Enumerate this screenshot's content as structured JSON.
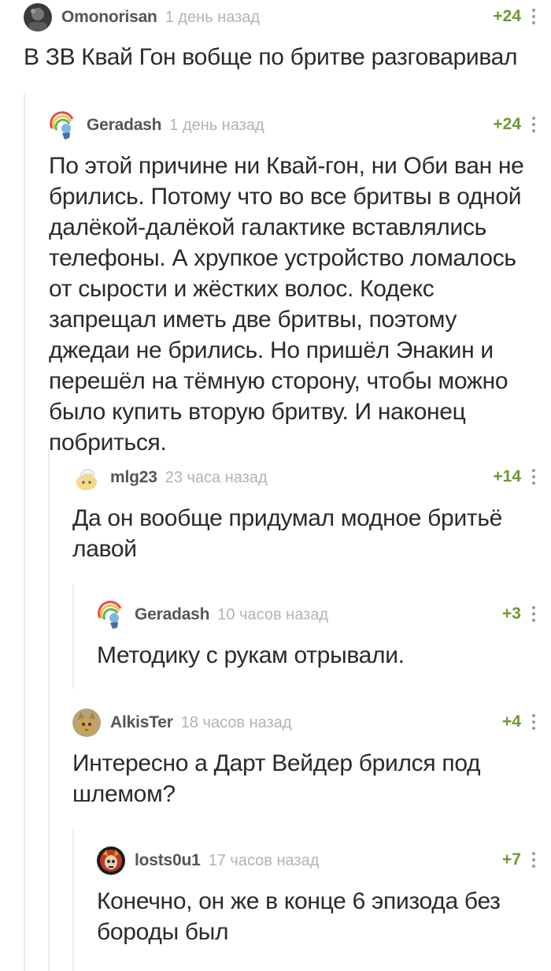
{
  "comments": [
    {
      "author": "Omonorisan",
      "time": "1 день назад",
      "rating": "+24",
      "text": "В ЗВ Квай Гон вобще по бритве разговаривал",
      "avatar": "photo-dark"
    },
    {
      "author": "Geradash",
      "time": "1 день назад",
      "rating": "+24",
      "text": "По этой причине ни Квай-гон, ни Оби ван не брились. Потому что во все бритвы в одной далёкой-далёкой галактике вставлялись телефоны. А хрупкое устройство ломалось от сырости и жёстких волос. Кодекс запрещал иметь две бритвы, поэтому джедаи не брились. Но пришёл Энакин и перешёл на тёмную сторону, чтобы можно было купить вторую бритву. И наконец побриться.",
      "avatar": "rainbow-pony"
    },
    {
      "author": "mlg23",
      "time": "23 часа назад",
      "rating": "+14",
      "text": "Да он вообще придумал модное бритьё лавой",
      "avatar": "hat-character"
    },
    {
      "author": "Geradash",
      "time": "10 часов назад",
      "rating": "+3",
      "text": "Методику с рукам отрывали.",
      "avatar": "rainbow-pony"
    },
    {
      "author": "AlkisTer",
      "time": "18 часов назад",
      "rating": "+4",
      "text": "Интересно а Дарт Вейдер брился под шлемом?",
      "avatar": "cat-photo"
    },
    {
      "author": "losts0u1",
      "time": "17 часов назад",
      "rating": "+7",
      "text": "Конечно, он же в конце 6 эпизода без бороды был",
      "avatar": "red-skull"
    }
  ],
  "colors": {
    "rating": "#6e9a30",
    "author": "#555555",
    "time": "#b3b3b3",
    "thread_line": "#ececec"
  }
}
